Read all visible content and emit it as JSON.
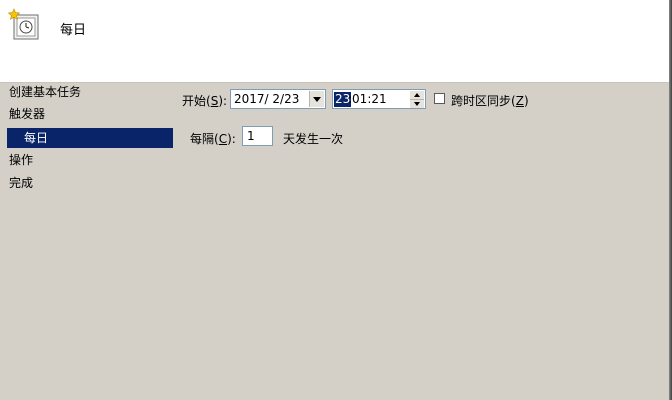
{
  "header": {
    "title": "每日",
    "icon": "calendar-clock-icon"
  },
  "steps": [
    {
      "label": "创建基本任务",
      "selected": false
    },
    {
      "label": "触发器",
      "selected": false
    },
    {
      "label": "每日",
      "selected": true
    },
    {
      "label": "操作",
      "selected": false
    },
    {
      "label": "完成",
      "selected": false
    }
  ],
  "form": {
    "start_label": "开始",
    "start_hotkey": "S",
    "start_date": "2017/ 2/23",
    "start_time_hour": "23",
    "start_time_rest": ":01:21",
    "sync_timezone_label": "跨时区同步",
    "sync_timezone_hotkey": "Z",
    "sync_timezone_checked": false,
    "recur_label": "每隔",
    "recur_hotkey": "C",
    "recur_value": "1",
    "recur_unit": "天发生一次"
  },
  "colors": {
    "background": "#d4d0c8",
    "selection": "#0a246a",
    "input_border": "#7f9db9"
  }
}
